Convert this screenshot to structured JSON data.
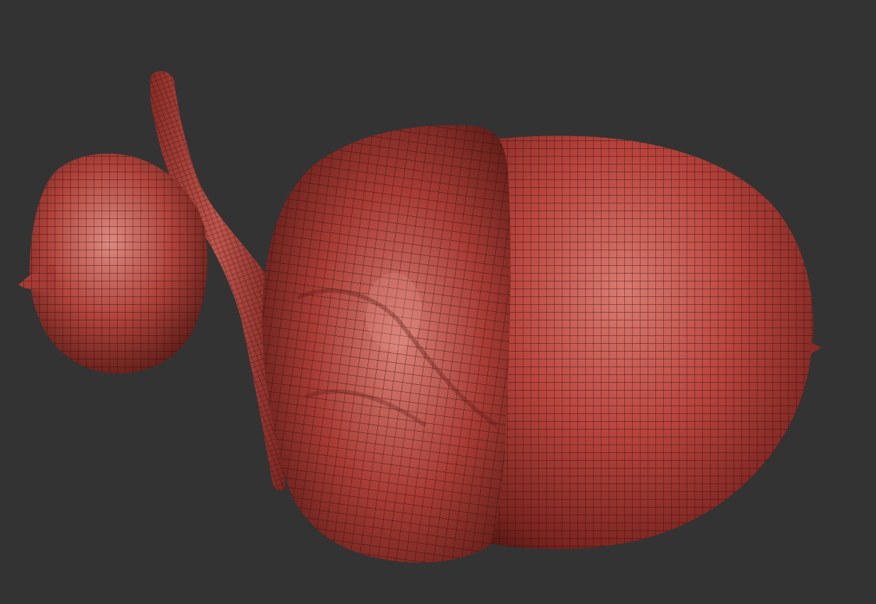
{
  "viewport": {
    "background": "#333333"
  },
  "material": {
    "base": "#b8453d",
    "highlight": "#e08a80",
    "shadow": "#4a1410",
    "wire": "#2a0a08"
  },
  "objects": [
    {
      "name": "acorn-nut"
    },
    {
      "name": "acorn-cap"
    },
    {
      "name": "twig"
    },
    {
      "name": "small-acorn"
    }
  ]
}
